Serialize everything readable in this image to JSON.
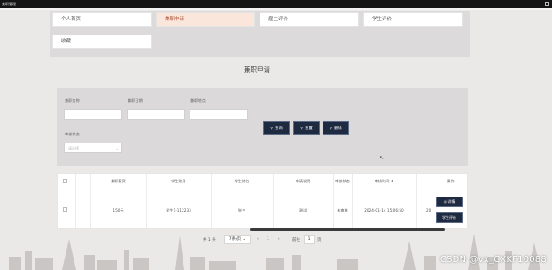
{
  "window": {
    "title": "兼职管理"
  },
  "nav": {
    "items": [
      {
        "label": "个人首页"
      },
      {
        "label": "兼职申请"
      },
      {
        "label": "雇主评价"
      },
      {
        "label": "学生评价"
      },
      {
        "label": "收藏"
      }
    ],
    "active": "兼职申请"
  },
  "page_title": "兼职申请",
  "search": {
    "label_name": "兼职名称",
    "label_date": "兼职日期",
    "label_place": "兼职地点",
    "label_status": "审核状态",
    "status_placeholder": "请选择",
    "btn_query": "查询",
    "btn_reset": "重置",
    "btn_delete": "删除"
  },
  "table": {
    "headers": [
      "兼职薪资",
      "学生账号",
      "学生姓名",
      "申请说明",
      "审核状态",
      "审核时间",
      "操作"
    ],
    "sort_icon": "⇕",
    "rows": [
      {
        "salary": "150元",
        "account": "学生1-112233",
        "name": "张三",
        "note": "测试",
        "status": "未审核",
        "time": "2024-01-14 15:06:50",
        "overflow": "20",
        "btn_detail": "详情",
        "btn_review": "学生评价"
      }
    ]
  },
  "pager": {
    "total": "共 1 条",
    "page_size": "7条/页",
    "current_page": "1",
    "goto_label": "前往",
    "goto_value": "1",
    "page_unit": "页"
  },
  "watermark": "CSDN @vx_CXKF10088",
  "colors": {
    "accent": "#1e2a40",
    "active_tab": "#fbe6dc",
    "page_bg": "#ebe9e8"
  }
}
